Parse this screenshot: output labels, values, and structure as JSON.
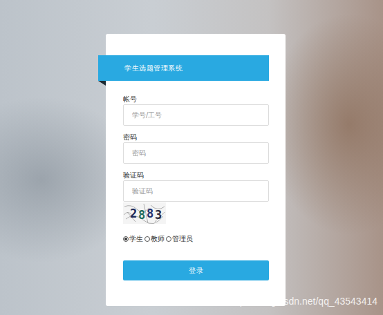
{
  "window": {
    "title": "学生选题管理系统"
  },
  "fields": [
    {
      "label": "帐号",
      "placeholder": "学号/工号",
      "kind": "text"
    },
    {
      "label": "密码",
      "placeholder": "密码",
      "kind": "password"
    },
    {
      "label": "验证码",
      "placeholder": "验证码",
      "kind": "text"
    }
  ],
  "captcha": {
    "text": "2883"
  },
  "roles": [
    {
      "label": "学生",
      "selected": true
    },
    {
      "label": "教师",
      "selected": false
    },
    {
      "label": "管理员",
      "selected": false
    }
  ],
  "login_button": {
    "label": "登录"
  },
  "watermark": "https://blog.csdn.net/qq_43543414"
}
